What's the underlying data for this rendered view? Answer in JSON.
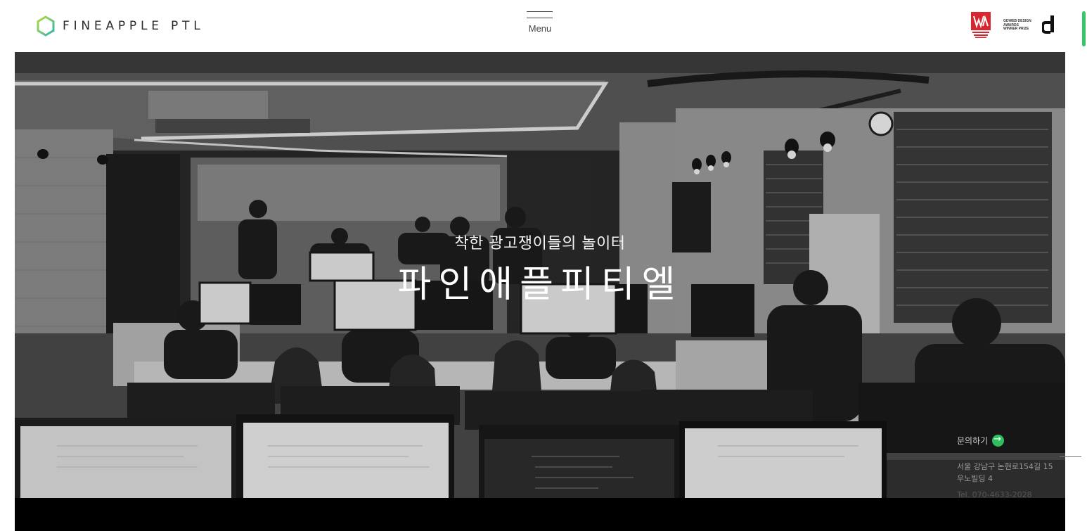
{
  "header": {
    "logo_text": "FINEAPPLE PTL",
    "menu_label": "Menu",
    "award_gd_text": [
      "GDWEB DESIGN",
      "AWARDS",
      "WINNER PRIZE"
    ]
  },
  "hero": {
    "subtitle": "착한 광고쟁이들의 놀이터",
    "title": "파인애플피티엘"
  },
  "contact": {
    "link_label": "문의하기",
    "address_line1": "서울 강남구 논현로154길 15",
    "address_line2": "우노빌딩 4",
    "tel": "Tel. 070-4633-2028"
  },
  "colors": {
    "accent": "#2fbf5f",
    "logo_gradient": [
      "#a8d84a",
      "#3fb8a8"
    ],
    "award_red": "#d7262f"
  }
}
